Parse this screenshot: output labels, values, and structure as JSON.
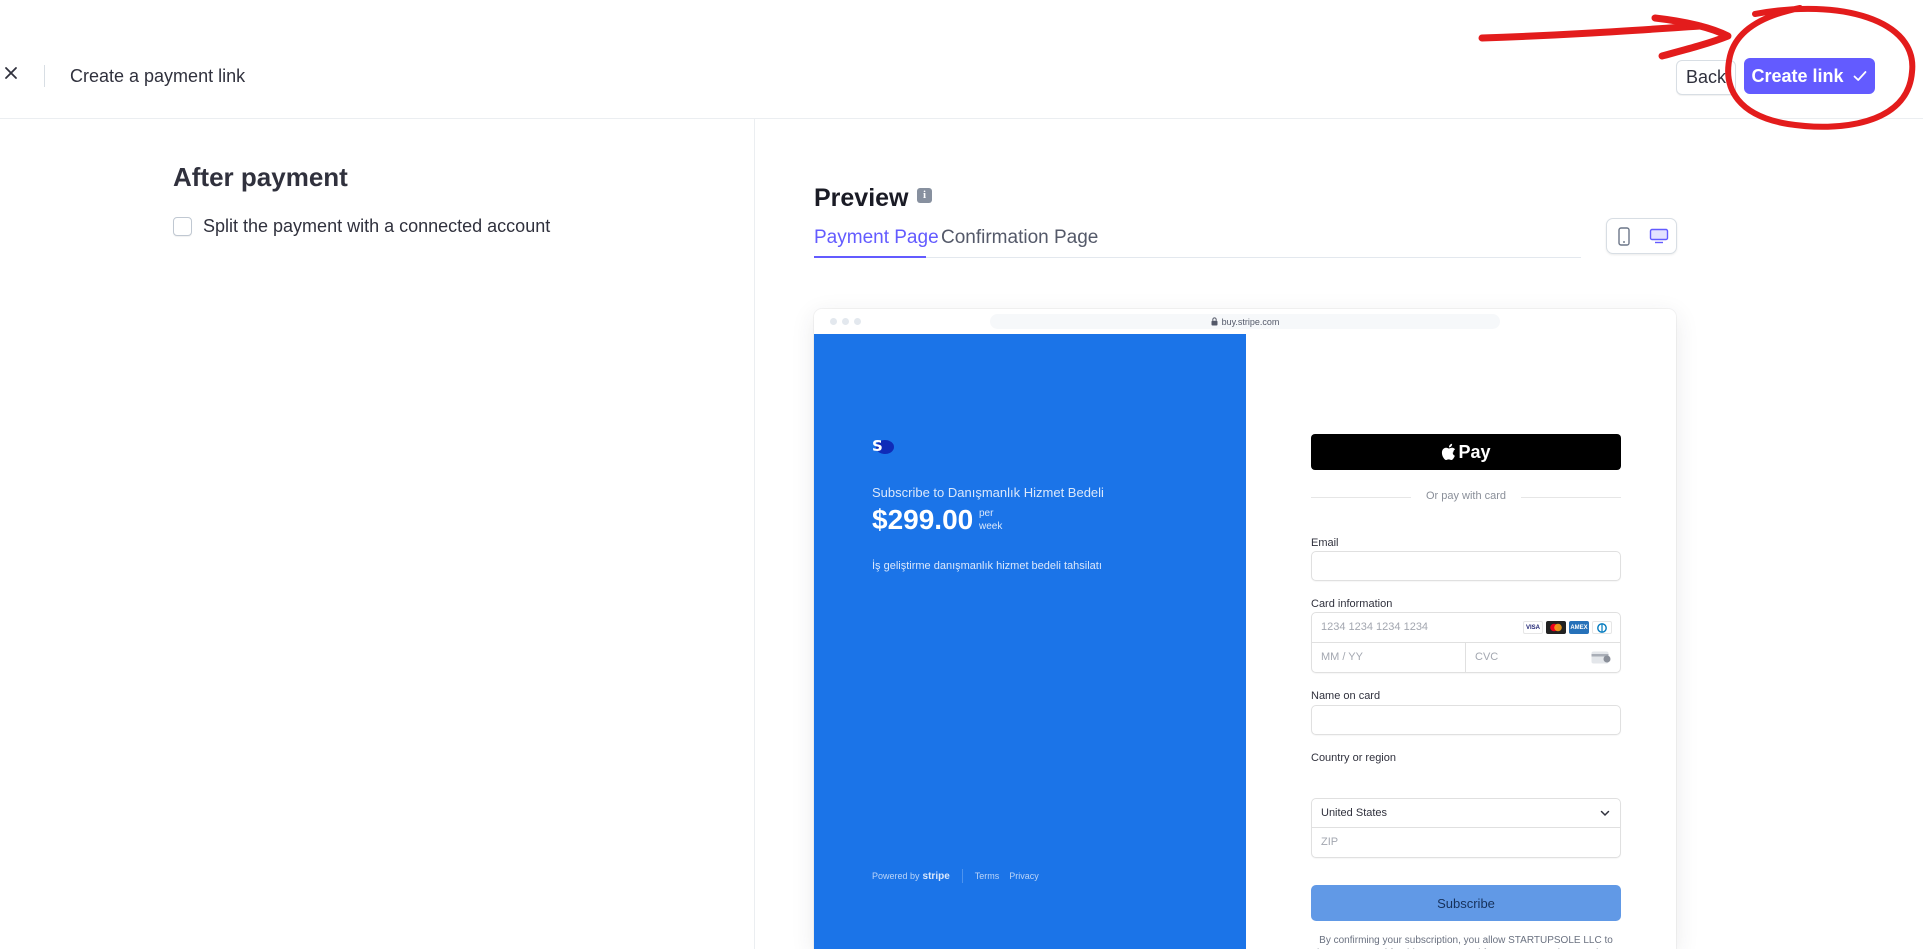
{
  "header": {
    "title": "Create a payment link",
    "back_label": "Back",
    "create_label": "Create link"
  },
  "after_payment": {
    "title": "After payment",
    "split_label": "Split the payment with a connected account",
    "split_checked": false
  },
  "preview": {
    "title": "Preview",
    "tabs": [
      {
        "label": "Payment Page",
        "active": true
      },
      {
        "label": "Confirmation Page",
        "active": false
      }
    ],
    "device_mode": "desktop",
    "url": "buy.stripe.com"
  },
  "checkout": {
    "brand_initial": "S",
    "subscribe_to": "Subscribe to Danışmanlık Hizmet Bedeli",
    "price": "$299.00",
    "per": "per",
    "week": "week",
    "description": "İş geliştirme danışmanlık hizmet bedeli tahsilatı",
    "powered_by": "Powered by",
    "stripe": "stripe",
    "terms": "Terms",
    "privacy": "Privacy",
    "apple_pay": "Pay",
    "or_pay": "Or pay with card",
    "email_label": "Email",
    "card_label": "Card information",
    "card_placeholder": "1234 1234 1234 1234",
    "exp_placeholder": "MM / YY",
    "cvc_placeholder": "CVC",
    "card_brands": [
      "VISA",
      "MC",
      "AMEX",
      "DC"
    ],
    "name_label": "Name on card",
    "country_label": "Country or region",
    "country_value": "United States",
    "zip_placeholder": "ZIP",
    "subscribe_label": "Subscribe",
    "consent": "By confirming your subscription, you allow STARTUPSOLE LLC to charge your card for this payment and future payments in accordance with their terms."
  },
  "colors": {
    "accent": "#635bff",
    "checkout_brand": "#1b74e8",
    "annotation": "#e31c1c"
  }
}
